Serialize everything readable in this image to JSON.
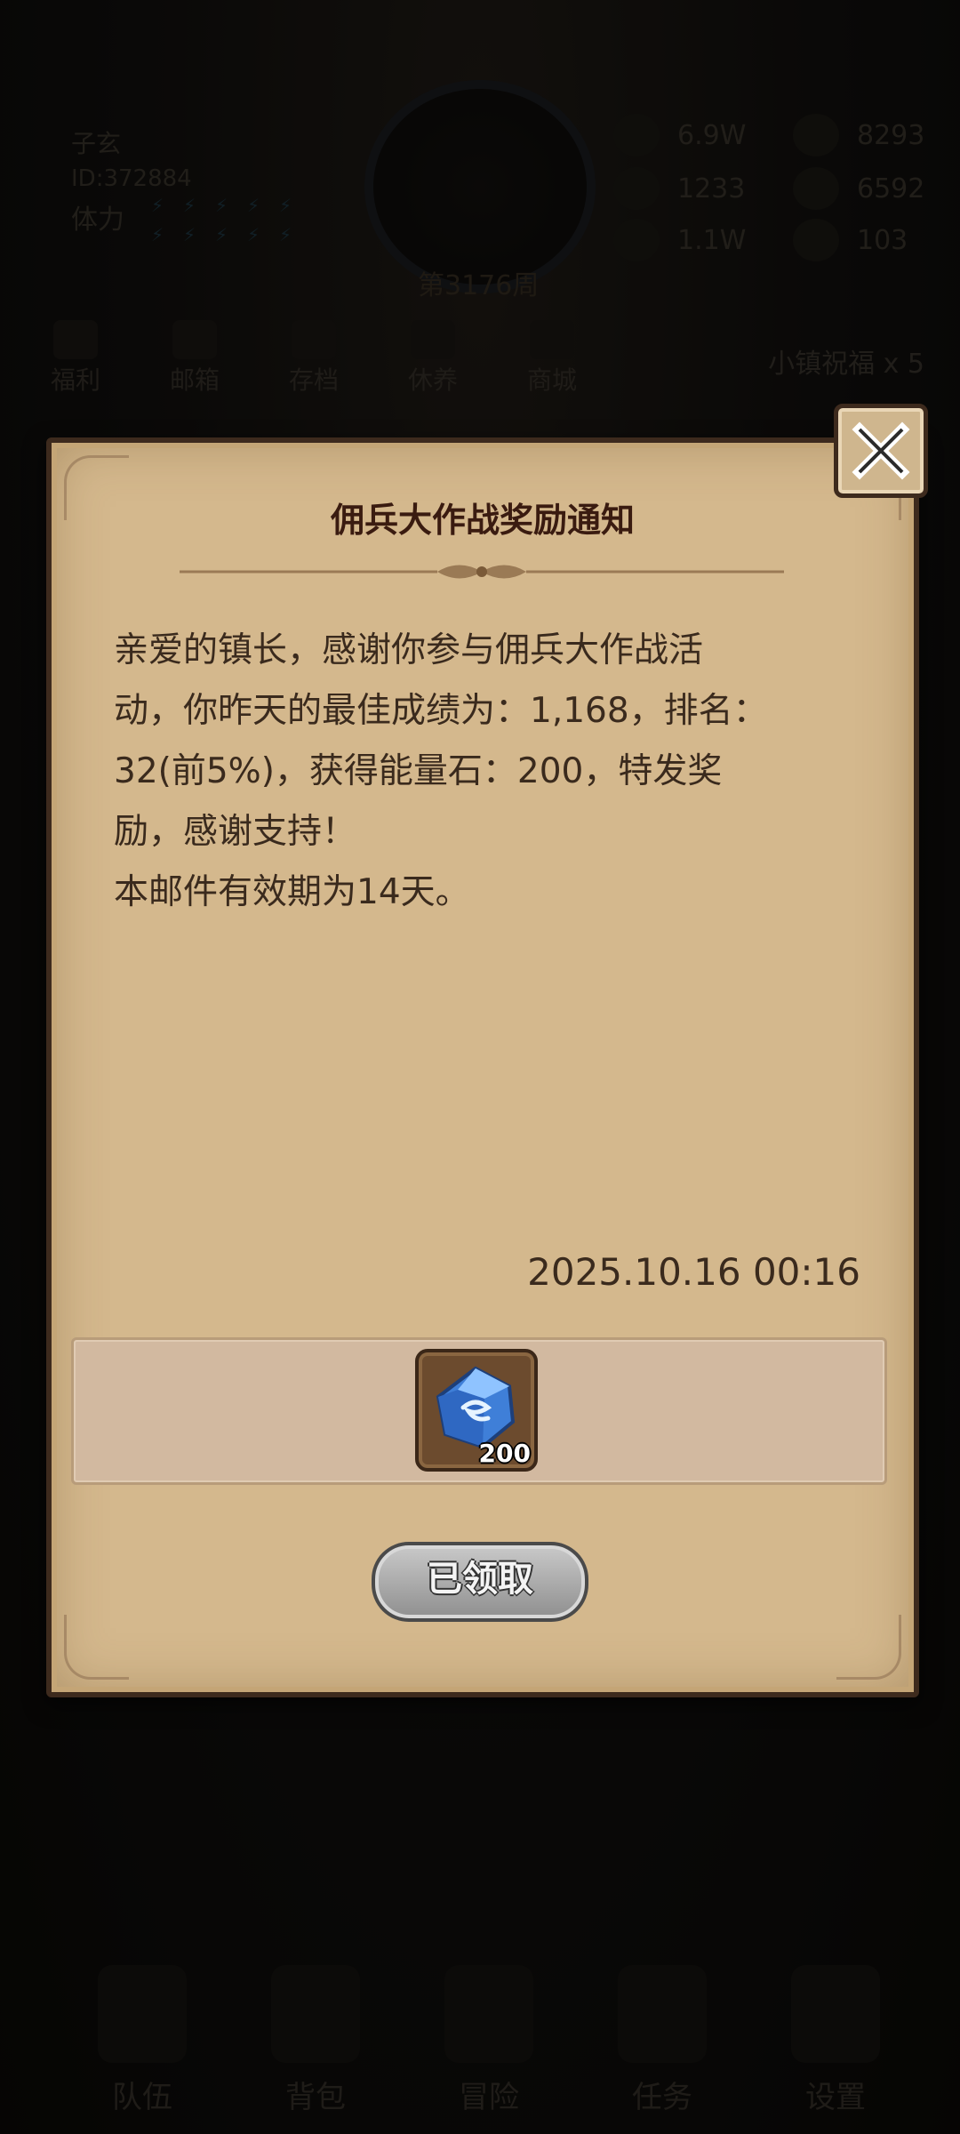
{
  "background": {
    "player_name": "子玄",
    "player_id": "ID:372884",
    "stamina_label": "体力",
    "week_label": "第3176周",
    "resources": [
      "6.9W",
      "8293",
      "1233",
      "6592",
      "1.1W",
      "103"
    ],
    "top_menu": [
      "福利",
      "邮箱",
      "存档",
      "休养",
      "商城"
    ],
    "blessing": "小镇祝福 x 5",
    "bottom_nav": [
      "队伍",
      "背包",
      "冒险",
      "任务",
      "设置"
    ]
  },
  "mail": {
    "title": "佣兵大作战奖励通知",
    "body": "亲爱的镇长，感谢你参与佣兵大作战活动，你昨天的最佳成绩为：1,168，排名：32(前5%)，获得能量石：200，特发奖励，感谢支持！\n本邮件有效期为14天。",
    "timestamp": "2025.10.16 00:16",
    "reward": {
      "item_icon": "energy-stone-icon",
      "count": "200"
    },
    "claim_status_label": "已领取"
  },
  "colors": {
    "parchment": "#d4b88d",
    "title_color": "#3a1b10",
    "border": "#3d2a1d"
  }
}
